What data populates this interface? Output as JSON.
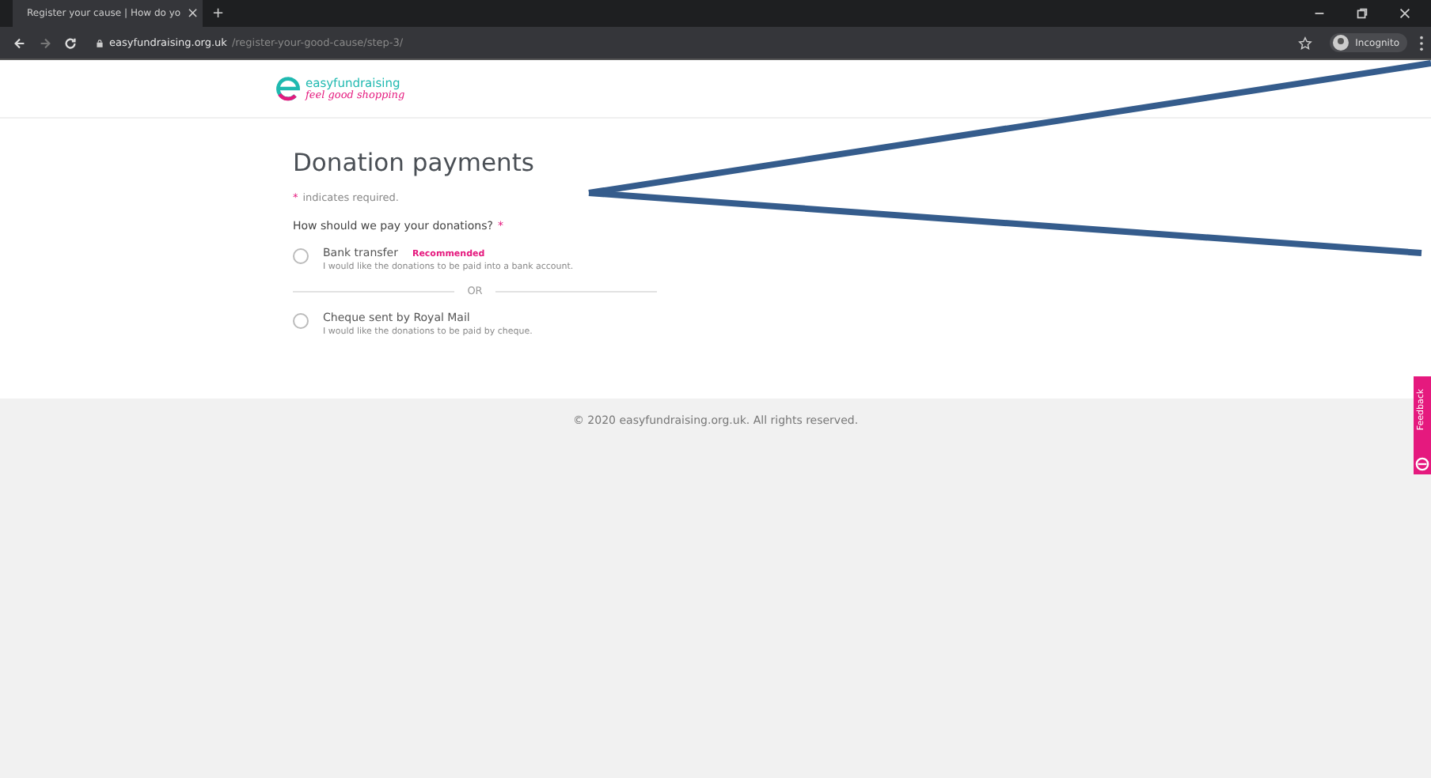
{
  "browser": {
    "tab_title": "Register your cause | How do yo",
    "tab_close": "×",
    "new_tab": "+",
    "url_domain": "easyfundraising.org.uk",
    "url_path": "/register-your-good-cause/step-3/",
    "profile": "Incognito"
  },
  "logo": {
    "name": "easyfundraising",
    "tagline": "feel good shopping"
  },
  "form": {
    "title": "Donation payments",
    "required_mark": "*",
    "required_note": "indicates required.",
    "question": "How should we pay your donations?",
    "question_mark": "*",
    "separator": "OR",
    "options": [
      {
        "label": "Bank transfer",
        "badge": "Recommended",
        "description": "I would like the donations to be paid into a bank account.",
        "selected": false
      },
      {
        "label": "Cheque sent by Royal Mail",
        "description": "I would like the donations to be paid by cheque.",
        "selected": false
      }
    ]
  },
  "footer": "© 2020 easyfundraising.org.uk. All rights reserved.",
  "feedback": {
    "label": "Feedback"
  }
}
